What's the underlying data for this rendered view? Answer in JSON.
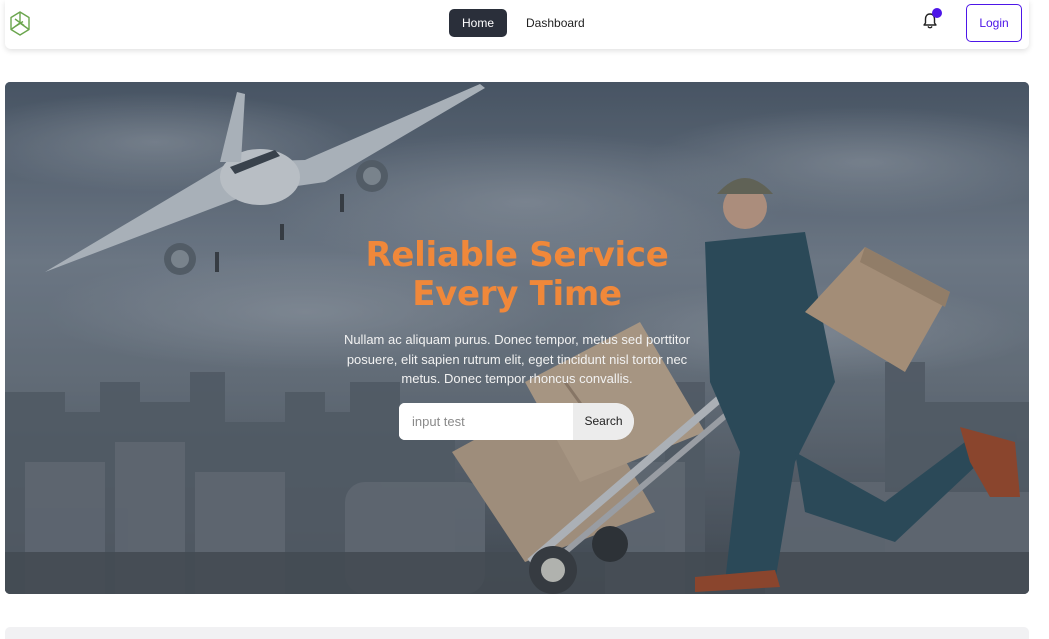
{
  "nav": {
    "logo_icon": "cube-logo-icon",
    "links": [
      {
        "label": "Home",
        "active": true
      },
      {
        "label": "Dashboard",
        "active": false
      }
    ],
    "bell_icon": "bell-icon",
    "login_label": "Login"
  },
  "hero": {
    "title_line1": "Reliable Service",
    "title_line2": "Every Time",
    "text": "Nullam ac aliquam purus. Donec tempor, metus sed porttitor posuere, elit sapien rutrum elit, eget tincidunt nisl tortor nec metus. Donec tempor rhoncus convallis.",
    "search": {
      "placeholder": "input test",
      "button_label": "Search"
    },
    "title_color": "#f0883a"
  },
  "colors": {
    "accent": "#4d16e8",
    "nav_active_bg": "#2a2f3a"
  }
}
